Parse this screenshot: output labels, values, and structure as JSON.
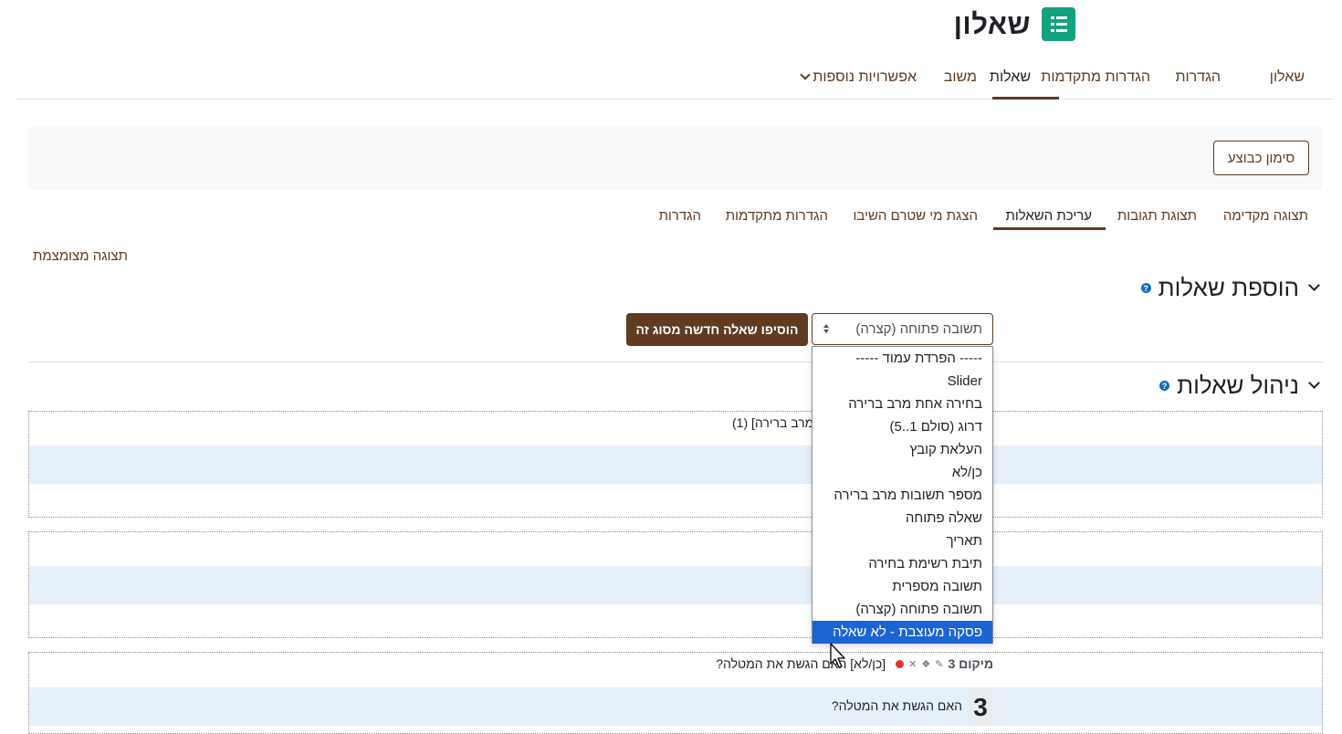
{
  "page": {
    "title": "שאלון",
    "module_icon": "survey-list-icon",
    "brand_color": "#5f3b22",
    "icon_color": "#13a27f"
  },
  "primary_nav": [
    {
      "label": "שאלון",
      "active": false
    },
    {
      "label": "הגדרות",
      "active": false
    },
    {
      "label": "הגדרות מתקדמות",
      "active": false
    },
    {
      "label": "שאלות",
      "active": true
    },
    {
      "label": "משוב",
      "active": false
    },
    {
      "label": "אפשרויות נוספות",
      "active": false,
      "has_dropdown": true
    }
  ],
  "action_bar": {
    "mark_done_label": "סימון כבוצע"
  },
  "secondary_nav": [
    {
      "label": "תצוגה מקדימה",
      "active": false
    },
    {
      "label": "תצוגת תגובות",
      "active": false
    },
    {
      "label": "עריכת השאלות",
      "active": true
    },
    {
      "label": "הצגת מי שטרם השיבו",
      "active": false
    },
    {
      "label": "הגדרות מתקדמות",
      "active": false
    },
    {
      "label": "הגדרות",
      "active": false
    }
  ],
  "compact_view_label": "תצוגה מצומצמת",
  "add_section": {
    "title": "הוספת שאלות",
    "select_value": "תשובה פתוחה (קצרה)",
    "add_button_label": "הוסיפו שאלה חדשה מסוג זה"
  },
  "question_type_options": [
    {
      "label": "----- הפרדת עמוד -----",
      "selected": false
    },
    {
      "label": "Slider",
      "selected": false
    },
    {
      "label": "בחירה אחת מרב ברירה",
      "selected": false
    },
    {
      "label": "דרוג (סולם 1..5)",
      "selected": false
    },
    {
      "label": "העלאת קובץ",
      "selected": false
    },
    {
      "label": "כן/לא",
      "selected": false
    },
    {
      "label": "מספר תשובות מרב ברירה",
      "selected": false
    },
    {
      "label": "שאלה פתוחה",
      "selected": false
    },
    {
      "label": "תאריך",
      "selected": false
    },
    {
      "label": "תיבת רשימת בחירה",
      "selected": false
    },
    {
      "label": "תשובה מספרית",
      "selected": false
    },
    {
      "label": "תשובה פתוחה (קצרה)",
      "selected": false
    },
    {
      "label": "פסקה מעוצבת - לא שאלה",
      "selected": true
    }
  ],
  "manage_section": {
    "title": "ניהול שאלות"
  },
  "questions": {
    "q1_label": "מרב ברירה] (1)",
    "q3": {
      "position_label": "מיקום 3",
      "label": "[כן/לא] האם הגשת את המטלה?",
      "number": "3",
      "text": "האם הגשת את המטלה?"
    }
  }
}
